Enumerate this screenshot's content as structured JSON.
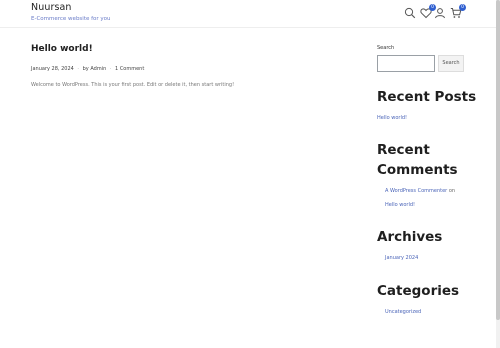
{
  "site": {
    "title": "Nuursan",
    "description": "E-Commerce website for you"
  },
  "header_icons": {
    "search": "search-icon",
    "wishlist": "heart-icon",
    "wishlist_count": "0",
    "account": "user-icon",
    "cart": "cart-icon",
    "cart_count": "0"
  },
  "post": {
    "title": "Hello world!",
    "date": "January 28, 2024",
    "author": "by Admin",
    "comments": "1 Comment",
    "excerpt": "Welcome to WordPress. This is your first post. Edit or delete it, then start writing!"
  },
  "sidebar": {
    "search": {
      "label": "Search",
      "value": "",
      "placeholder": "",
      "button": "Search"
    },
    "recent_posts": {
      "title": "Recent Posts",
      "items": [
        "Hello world!"
      ]
    },
    "recent_comments": {
      "title_line1": "Recent",
      "title_line2": "Comments",
      "commenter": "A WordPress Commenter",
      "on": "on",
      "post": "Hello world!"
    },
    "archives": {
      "title": "Archives",
      "items": [
        "January 2024"
      ]
    },
    "categories": {
      "title": "Categories",
      "items": [
        "Uncategorized"
      ]
    }
  },
  "colors": {
    "accent": "#2f5fd0",
    "link": "#4a64b8",
    "tagline": "#6a7cc8"
  }
}
